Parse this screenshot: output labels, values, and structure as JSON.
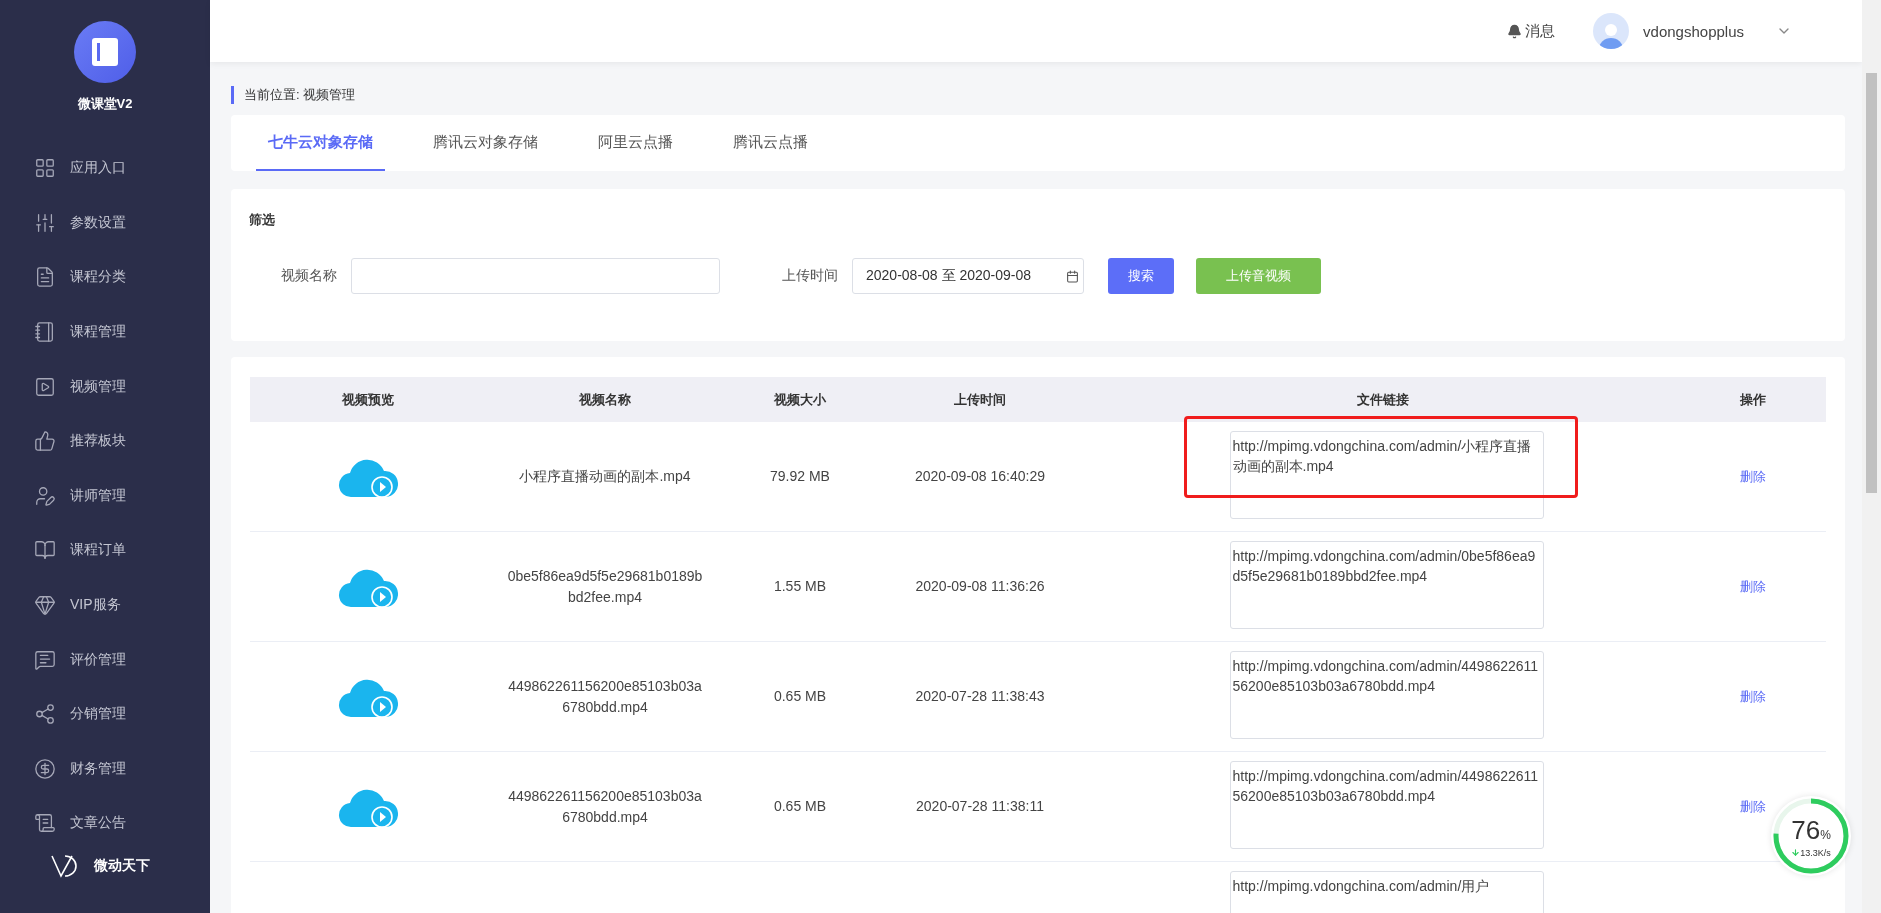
{
  "sidebar": {
    "app_name": "微课堂V2",
    "items": [
      {
        "label": "应用入口"
      },
      {
        "label": "参数设置"
      },
      {
        "label": "课程分类"
      },
      {
        "label": "课程管理"
      },
      {
        "label": "视频管理"
      },
      {
        "label": "推荐板块"
      },
      {
        "label": "讲师管理"
      },
      {
        "label": "课程订单"
      },
      {
        "label": "VIP服务"
      },
      {
        "label": "评价管理"
      },
      {
        "label": "分销管理"
      },
      {
        "label": "财务管理"
      },
      {
        "label": "文章公告"
      }
    ],
    "footer_brand": "微动天下"
  },
  "header": {
    "notifications": "消息",
    "username": "vdongshopplus"
  },
  "breadcrumb": "当前位置: 视频管理",
  "tabs": [
    {
      "label": "七牛云对象存储",
      "selected": true
    },
    {
      "label": "腾讯云对象存储",
      "selected": false
    },
    {
      "label": "阿里云点播",
      "selected": false
    },
    {
      "label": "腾讯云点播",
      "selected": false
    }
  ],
  "filter": {
    "title": "筛选",
    "fields": [
      {
        "label": "视频名称",
        "kind": "text"
      },
      {
        "label": "上传时间",
        "kind": "date_range",
        "value": "2020-08-08 至 2020-09-08"
      }
    ],
    "buttons": [
      {
        "label": "搜索",
        "kind": "primary"
      },
      {
        "label": "上传音视频",
        "kind": "success"
      }
    ]
  },
  "table": {
    "columns": [
      "视频预览",
      "视频名称",
      "视频大小",
      "上传时间",
      "文件链接",
      "操作"
    ],
    "rows": [
      {
        "kind": "full",
        "name": "小程序直播动画的副本.mp4",
        "size": "79.92 MB",
        "uploaded": "2020-09-08 16:40:29",
        "link": "http://mpimg.vdongchina.com/admin/小程序直播动画的副本.mp4",
        "action": "删除",
        "highlighted": true
      },
      {
        "kind": "full",
        "name": "0be5f86ea9d5f5e29681b0189bbd2fee.mp4",
        "size": "1.55 MB",
        "uploaded": "2020-09-08 11:36:26",
        "link": "http://mpimg.vdongchina.com/admin/0be5f86ea9d5f5e29681b0189bbd2fee.mp4",
        "action": "删除",
        "highlighted": false
      },
      {
        "kind": "full",
        "name": "449862261156200e85103b03a6780bdd.mp4",
        "size": "0.65 MB",
        "uploaded": "2020-07-28 11:38:43",
        "link": "http://mpimg.vdongchina.com/admin/449862261156200e85103b03a6780bdd.mp4",
        "action": "删除",
        "highlighted": false
      },
      {
        "kind": "full",
        "name": "449862261156200e85103b03a6780bdd.mp4",
        "size": "0.65 MB",
        "uploaded": "2020-07-28 11:38:11",
        "link": "http://mpimg.vdongchina.com/admin/449862261156200e85103b03a6780bdd.mp4",
        "action": "删除",
        "highlighted": false
      },
      {
        "kind": "cut",
        "link": "http://mpimg.vdongchina.com/admin/用户",
        "highlighted": false
      }
    ]
  },
  "speed_widget": {
    "percent": "76",
    "unit": "%",
    "rate": "13.3K/s",
    "level": 0.76
  }
}
